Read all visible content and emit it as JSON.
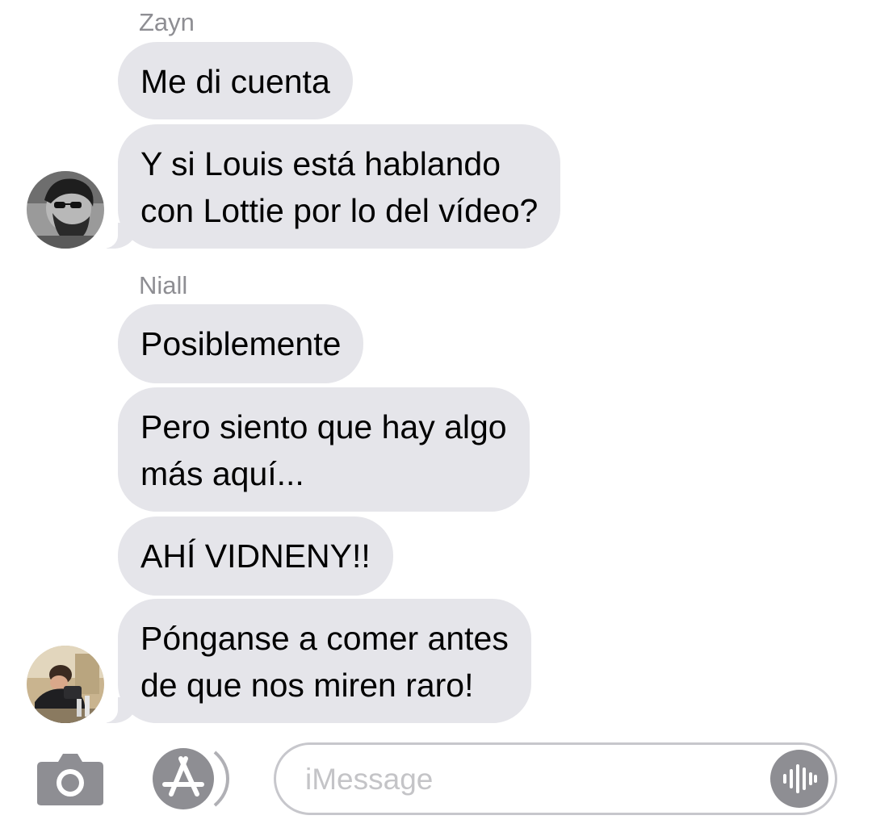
{
  "conversation": {
    "groups": [
      {
        "sender": "Zayn",
        "messages": [
          {
            "lines": [
              "Me di cuenta"
            ]
          },
          {
            "lines": [
              "Y si Louis está hablando",
              "con Lottie por lo del vídeo?"
            ]
          }
        ]
      },
      {
        "sender": "Niall",
        "messages": [
          {
            "lines": [
              "Posiblemente"
            ]
          },
          {
            "lines": [
              "Pero siento que hay algo",
              "más aquí..."
            ]
          },
          {
            "lines": [
              "AHÍ VIDNENY!!"
            ]
          },
          {
            "lines": [
              "Pónganse a comer antes",
              "de que nos miren raro!"
            ]
          }
        ]
      }
    ]
  },
  "composer": {
    "placeholder": "iMessage",
    "camera_icon": "camera-icon",
    "apps_icon": "app-store-icon",
    "audio_icon": "audio-waveform-icon"
  },
  "colors": {
    "bubble_incoming": "#e5e5ea",
    "sender_name": "#8e8e93",
    "icon_gray": "#8e8e93",
    "input_border": "#c7c7cc",
    "placeholder": "#c4c4c7"
  }
}
